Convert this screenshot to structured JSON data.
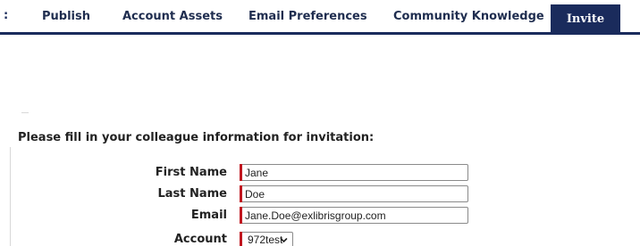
{
  "nav": {
    "overflow_glyph": ":",
    "tabs": [
      {
        "label": "Publish"
      },
      {
        "label": "Account Assets"
      },
      {
        "label": "Email Preferences"
      },
      {
        "label": "Community Knowledge"
      }
    ],
    "active_tab": {
      "label": "Invite"
    }
  },
  "colors": {
    "nav_dark": "#1a2b5c",
    "required_marker": "#c0161f"
  },
  "form": {
    "intro": "Please fill in your colleague information for invitation:",
    "first_name": {
      "label": "First Name",
      "value": "Jane"
    },
    "last_name": {
      "label": "Last Name",
      "value": "Doe"
    },
    "email": {
      "label": "Email",
      "value": "Jane.Doe@exlibrisgroup.com"
    },
    "account": {
      "label": "Account",
      "selected": "972test",
      "icon": "chevron-down-icon"
    }
  }
}
